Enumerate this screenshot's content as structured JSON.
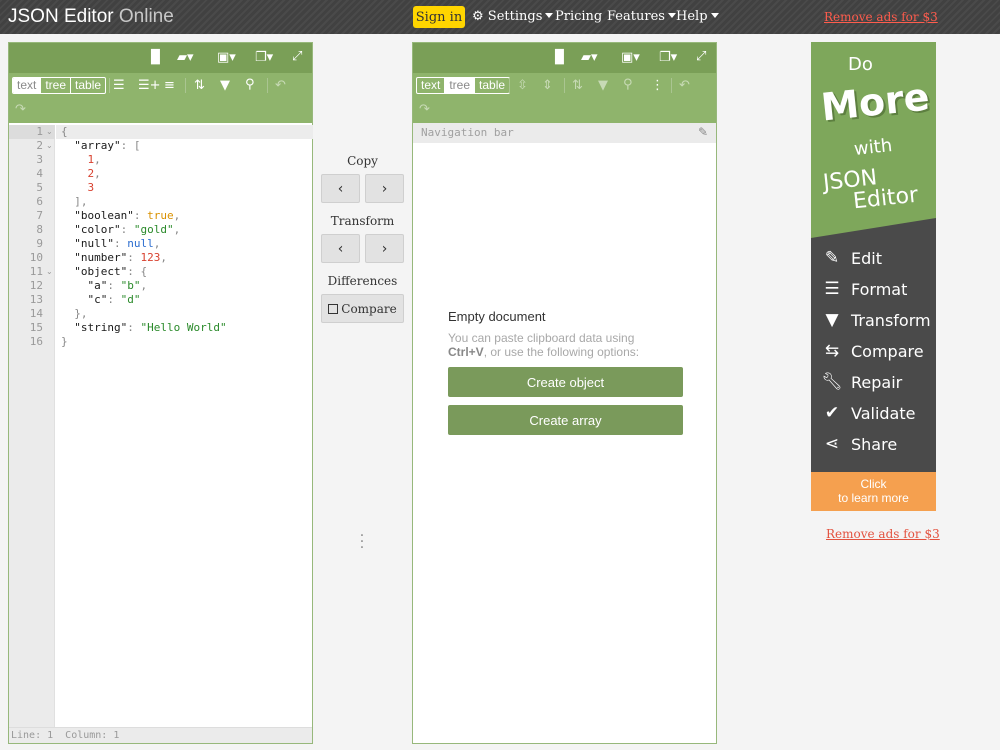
{
  "header": {
    "logo_main": "JSON Editor",
    "logo_light": " Online",
    "signin": "Sign in",
    "nav": [
      "Settings",
      "Pricing",
      "Features",
      "Help"
    ],
    "remove_ads": "Remove ads for $3"
  },
  "left_panel": {
    "modes": [
      "text",
      "tree",
      "table"
    ],
    "active_mode": "text",
    "line_numbers": [
      "1",
      "2",
      "3",
      "4",
      "5",
      "6",
      "7",
      "8",
      "9",
      "10",
      "11",
      "12",
      "13",
      "14",
      "15",
      "16"
    ],
    "status": "Line: 1  Column: 1"
  },
  "middle": {
    "copy_label": "Copy",
    "transform_label": "Transform",
    "differences_label": "Differences",
    "compare_label": "Compare"
  },
  "right_panel": {
    "modes": [
      "text",
      "tree",
      "table"
    ],
    "active_mode": "tree",
    "navbar": "Navigation bar",
    "empty_title": "Empty document",
    "empty_line1": "You can paste clipboard data using",
    "empty_key": "Ctrl+V",
    "empty_line2": ", or use the following options:",
    "create_object": "Create object",
    "create_array": "Create array"
  },
  "ad": {
    "do": "Do",
    "more": "More",
    "with": "with",
    "json": "JSON",
    "editor": "Editor",
    "features": [
      "Edit",
      "Format",
      "Transform",
      "Compare",
      "Repair",
      "Validate",
      "Share"
    ],
    "cta_line1": "Click",
    "cta_line2": "to learn more",
    "remove_ads": "Remove ads for $3"
  },
  "colors": {
    "menubar": "#7a9f57",
    "toolbar": "#8fb46c",
    "signin": "#ffd500",
    "ad_green": "#7ea75b",
    "ad_cta": "#f5a04f",
    "link": "#e3523f"
  }
}
